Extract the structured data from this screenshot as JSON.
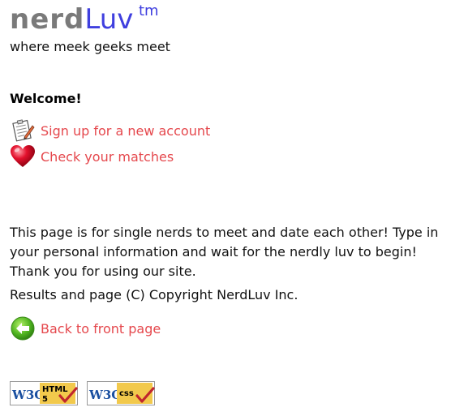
{
  "banner": {
    "logo_nerd": "nerd",
    "logo_luv": "Luv",
    "logo_tm": "tm",
    "tagline": "where meek geeks meet"
  },
  "welcome": {
    "heading": "Welcome!",
    "links": [
      {
        "label": "Sign up for a new account",
        "icon": "signup-form-icon"
      },
      {
        "label": "Check your matches",
        "icon": "heart-icon"
      }
    ]
  },
  "footer": {
    "intro": "This page is for single nerds to meet and date each other! Type in your personal information and wait for the nerdly luv to begin! Thank you for using our site.",
    "copyright": "Results and page (C) Copyright NerdLuv Inc.",
    "back_label": "Back to front page",
    "back_icon": "back-arrow-icon",
    "badges": [
      {
        "name": "w3c-html5-badge",
        "w3c": "W3C",
        "text1": "HTML",
        "text2": "5"
      },
      {
        "name": "w3c-css-badge",
        "w3c": "W3C",
        "text1": "css",
        "text2": ""
      }
    ]
  },
  "colors": {
    "logo_gray": "#7a7a7a",
    "logo_blue": "#3f3fdf",
    "link_red": "#e5484d",
    "badge_gold": "#f2c94c"
  }
}
